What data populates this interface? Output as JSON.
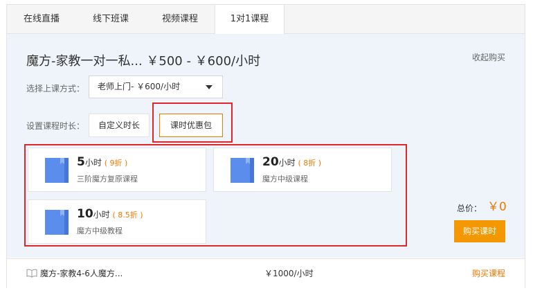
{
  "tabs": [
    {
      "label": "在线直播"
    },
    {
      "label": "线下班课"
    },
    {
      "label": "视频课程"
    },
    {
      "label": "1对1课程"
    }
  ],
  "course": {
    "title": "魔方-家教一对一私... ￥500 - ￥600/小时",
    "collapse_label": "收起购买"
  },
  "method": {
    "label": "选择上课方式：",
    "selected": "老师上门- ￥600/小时"
  },
  "duration": {
    "label": "设置课程时长：",
    "custom_label": "自定义时长",
    "package_label": "课时优惠包"
  },
  "packages": [
    {
      "hours": "5",
      "unit": "小时",
      "discount": "( 9折 )",
      "desc": "三阶魔方复原课程"
    },
    {
      "hours": "20",
      "unit": "小时",
      "discount": "( 8折 )",
      "desc": "魔方中级课程"
    },
    {
      "hours": "10",
      "unit": "小时",
      "discount": "( 8.5折 )",
      "desc": "魔方中级教程"
    }
  ],
  "total": {
    "label": "总价：",
    "value": "￥0",
    "buy_label": "购买课时"
  },
  "other_course": {
    "name": "魔方-家教4-6人魔方...",
    "price": "￥1000/小时",
    "buy_label": "购买课程"
  },
  "colors": {
    "accent": "#f07800",
    "button": "#f39800",
    "highlight_box": "#e0262b",
    "book_icon": "#5b8ded"
  }
}
